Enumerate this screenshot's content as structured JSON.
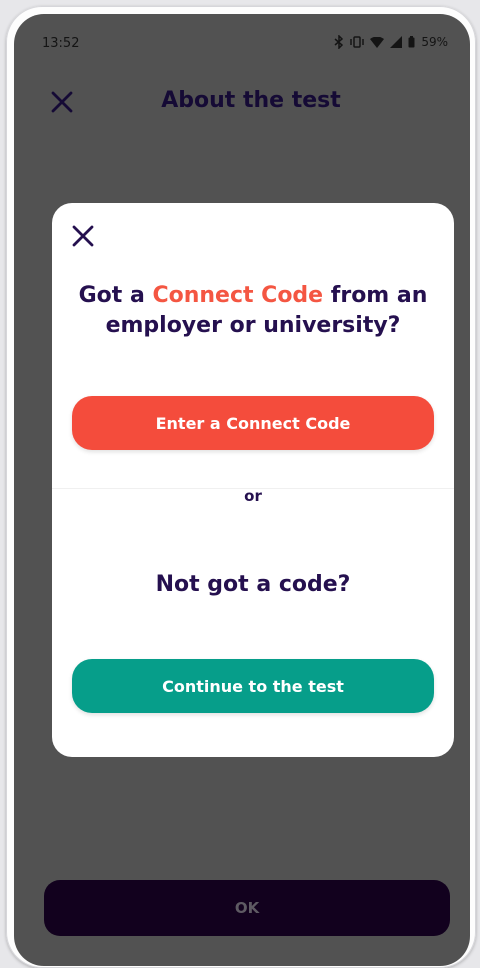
{
  "status_bar": {
    "time": "13:52",
    "battery_percent": "59%",
    "icons": [
      "bluetooth-icon",
      "vibrate-icon",
      "wifi-icon",
      "signal-icon",
      "battery-icon"
    ]
  },
  "header": {
    "title": "About the test",
    "close_icon": "close-icon"
  },
  "modal": {
    "close_icon": "close-icon",
    "heading_part1": "Got a ",
    "heading_accent": "Connect Code",
    "heading_part2": " from an employer or university?",
    "connect_button_label": "Enter a Connect Code",
    "or_label": "or",
    "subheading": "Not got a code?",
    "continue_button_label": "Continue to the test"
  },
  "footer": {
    "ok_label": "OK"
  },
  "colors": {
    "overlay": "#525252",
    "brand_text": "#25104f",
    "accent_coral": "#f44c3c",
    "accent_teal": "#069e8a",
    "ok_button_bg": "#12011e"
  }
}
